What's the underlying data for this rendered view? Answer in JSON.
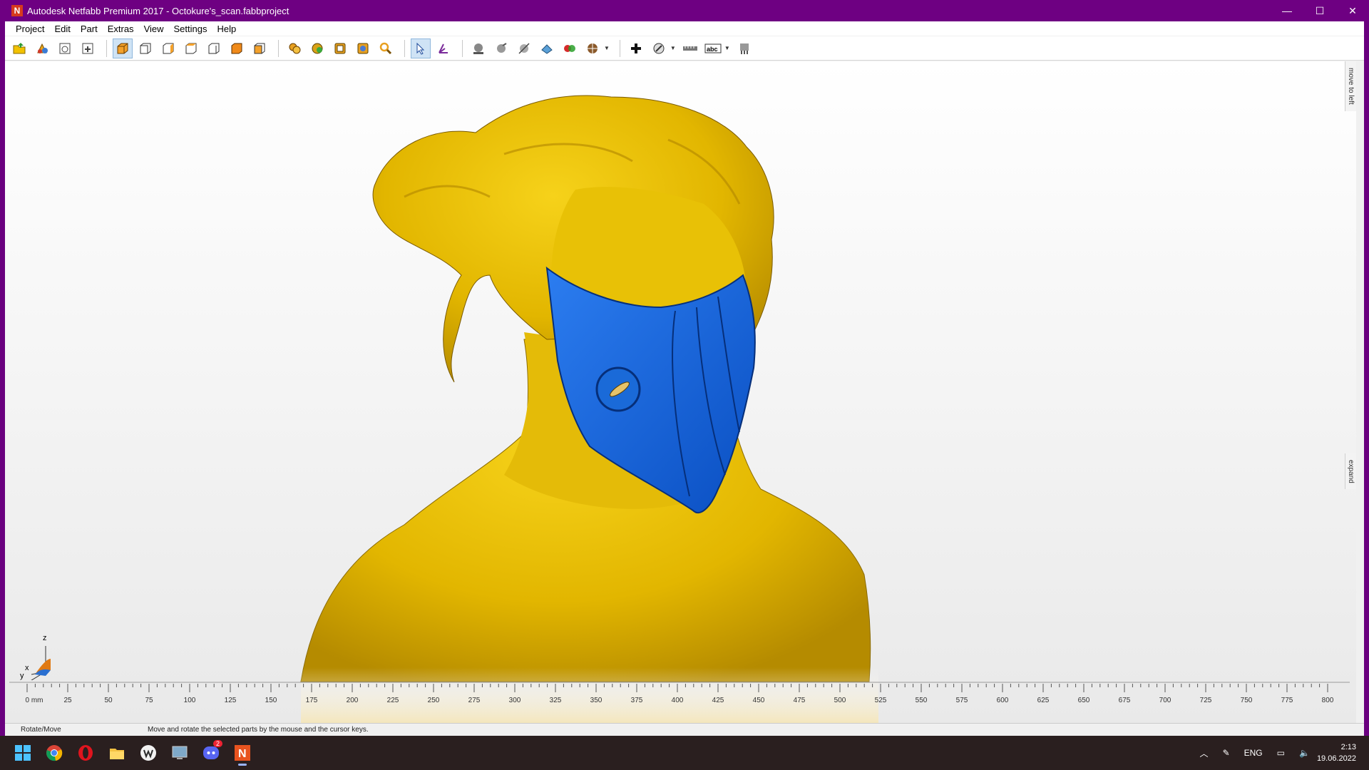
{
  "window": {
    "logo_letter": "N",
    "title": "Autodesk Netfabb Premium 2017 - Octokure's_scan.fabbproject",
    "minimize_glyph": "—",
    "maximize_glyph": "☐",
    "close_glyph": "✕"
  },
  "menubar": {
    "items": [
      {
        "label": "Project"
      },
      {
        "label": "Edit"
      },
      {
        "label": "Part"
      },
      {
        "label": "Extras"
      },
      {
        "label": "View"
      },
      {
        "label": "Settings"
      },
      {
        "label": "Help"
      }
    ]
  },
  "toolbar": {
    "icons": [
      "open-project-icon",
      "add-part-icon",
      "new-page-icon",
      "add-page-icon",
      "view-default-icon",
      "view-front-icon",
      "view-back-icon",
      "view-left-icon",
      "view-right-icon",
      "view-top-icon",
      "view-bottom-icon",
      "zoom-parts-icon",
      "zoom-all-icon",
      "zoom-platform-icon",
      "zoom-window-icon",
      "zoom-icon",
      "select-tool-icon",
      "rotate-tool-icon",
      "shading-icon",
      "lighting-icon",
      "clipping-icon",
      "slicing-icon",
      "color-icon",
      "render-options-icon",
      "add-point-icon",
      "measure-icon",
      "ruler-icon",
      "label-icon",
      "support-icon"
    ]
  },
  "side_tabs": {
    "top": "move to left",
    "bottom": "expand"
  },
  "axes": {
    "z": "z",
    "x": "x",
    "y": "y"
  },
  "ruler": {
    "labels": [
      "0 mm",
      "25",
      "50",
      "75",
      "100",
      "125",
      "150",
      "175",
      "200",
      "225",
      "250",
      "275",
      "300",
      "325",
      "350",
      "375",
      "400",
      "425",
      "450",
      "475",
      "500",
      "525",
      "550",
      "575",
      "600",
      "625",
      "650",
      "675",
      "700",
      "725",
      "750",
      "775",
      "800"
    ]
  },
  "statusbar": {
    "mode": "Rotate/Move",
    "hint": "Move and rotate the selected parts by the mouse and the cursor keys."
  },
  "taskbar": {
    "apps": [
      "windows-start-icon",
      "chrome-icon",
      "opera-icon",
      "file-explorer-icon",
      "wps-icon",
      "screen-icon",
      "discord-icon",
      "netfabb-icon"
    ],
    "discord_badge": "2",
    "language": "ENG",
    "time": "2:13",
    "date": "19.06.2022"
  },
  "colors": {
    "titlebar": "#6e0082",
    "model_yellow": "#e8c000",
    "mask_blue": "#0b63dd",
    "taskbar": "#2a1f1f"
  }
}
